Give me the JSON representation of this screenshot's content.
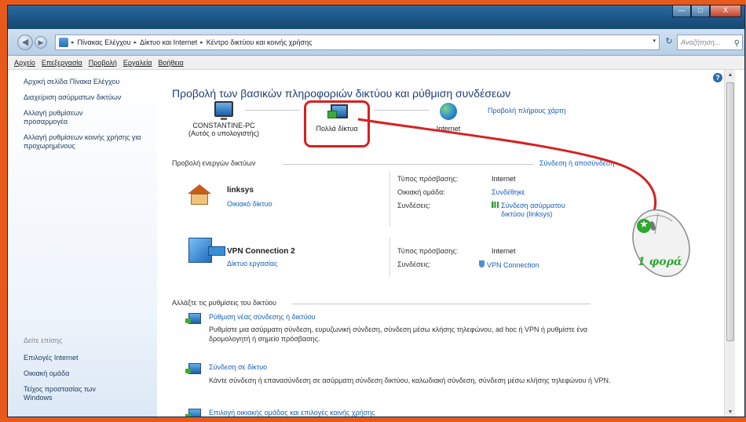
{
  "window": {
    "minimize_glyph": "—",
    "maximize_glyph": "□",
    "close_glyph": "X"
  },
  "address_bar": {
    "back_glyph": "◀",
    "forward_glyph": "▶",
    "breadcrumbs": [
      "Πίνακας Ελέγχου",
      "Δίκτυο και Internet",
      "Κέντρο δικτύου και κοινής χρήσης"
    ],
    "separator": "▸",
    "dropdown_glyph": "▾",
    "refresh_glyph": "↻",
    "search_placeholder": "Αναζήτηση...",
    "search_glyph": "⚲"
  },
  "menu": [
    "Αρχείο",
    "Επεξεργασία",
    "Προβολή",
    "Εργαλεία",
    "Βοήθεια"
  ],
  "sidebar": {
    "links": [
      "Αρχική σελίδα Πίνακα Ελέγχου",
      "Διαχείριση ασύρματων δικτύων",
      "Αλλαγή ρυθμίσεων προσαρμογέα",
      "Αλλαγή ρυθμίσεων κοινής χρήσης για προχωρημένους"
    ],
    "see_also": "Δείτε επίσης",
    "bottom_links": [
      "Επιλογές Internet",
      "Οικιακή ομάδα",
      "Τείχος προστασίας των Windows"
    ]
  },
  "main": {
    "help_glyph": "?",
    "title": "Προβολή των βασικών πληροφοριών δικτύου και ρύθμιση συνδέσεων",
    "full_map_link": "Προβολή πλήρους χάρτη",
    "map": {
      "pc_name": "CONSTANTINE-PC",
      "pc_sub": "(Αυτός ο υπολογιστής)",
      "middle": "Πολλά δίκτυα",
      "internet": "Internet"
    },
    "active_networks": {
      "header": "Προβολή ενεργών δικτύων",
      "connect_link": "Σύνδεση ή αποσύνδεση",
      "networks": [
        {
          "name": "linksys",
          "type": "Οικιακό δίκτυο",
          "access_label": "Τύπος πρόσβασης:",
          "access_value": "Internet",
          "homegroup_label": "Οικιακή ομάδα:",
          "homegroup_value": "Συνδέθηκε",
          "conn_label": "Συνδέσεις:",
          "conn_value_line1": "Σύνδεση ασύρματου",
          "conn_value_line2": "δικτύου (linksys)"
        },
        {
          "name": "VPN Connection  2",
          "type": "Δίκτυο εργασίας",
          "access_label": "Τύπος πρόσβασης:",
          "access_value": "Internet",
          "conn_label": "Συνδέσεις:",
          "conn_value": "VPN Connection"
        }
      ]
    },
    "change_settings": {
      "header": "Αλλάξτε τις ρυθμίσεις του δικτύου",
      "tasks": [
        {
          "title": "Ρύθμιση νέας σύνδεσης ή δικτύου",
          "desc": "Ρυθμίστε μια ασύρματη σύνδεση, ευρυζωνική σύνδεση,  σύνδεση μέσω κλήσης τηλεφώνου, ad hoc ή VPN ή ρυθμίστε ένα δρομολογητή ή σημείο πρόσβασης."
        },
        {
          "title": "Σύνδεση σε δίκτυο",
          "desc": "Κάντε σύνδεση ή επανασύνδεση σε ασύρματη σύνδεση δικτύου, καλωδιακή σύνδεση, σύνδεση μέσω κλήσης τηλεφώνου ή VPN."
        },
        {
          "title": "Επιλογή οικιακής ομάδας και επιλογές κοινής χρήσης",
          "desc": ""
        }
      ]
    }
  },
  "annotation": {
    "clicks_label": "1 φορά"
  },
  "scrollbar": {
    "up_glyph": "▲",
    "down_glyph": "▼"
  },
  "colors": {
    "frame_border": "#e8591c",
    "highlight": "#d82020",
    "link": "#1560b8",
    "title": "#1e3f75",
    "annotation_text": "#2ea82e"
  }
}
